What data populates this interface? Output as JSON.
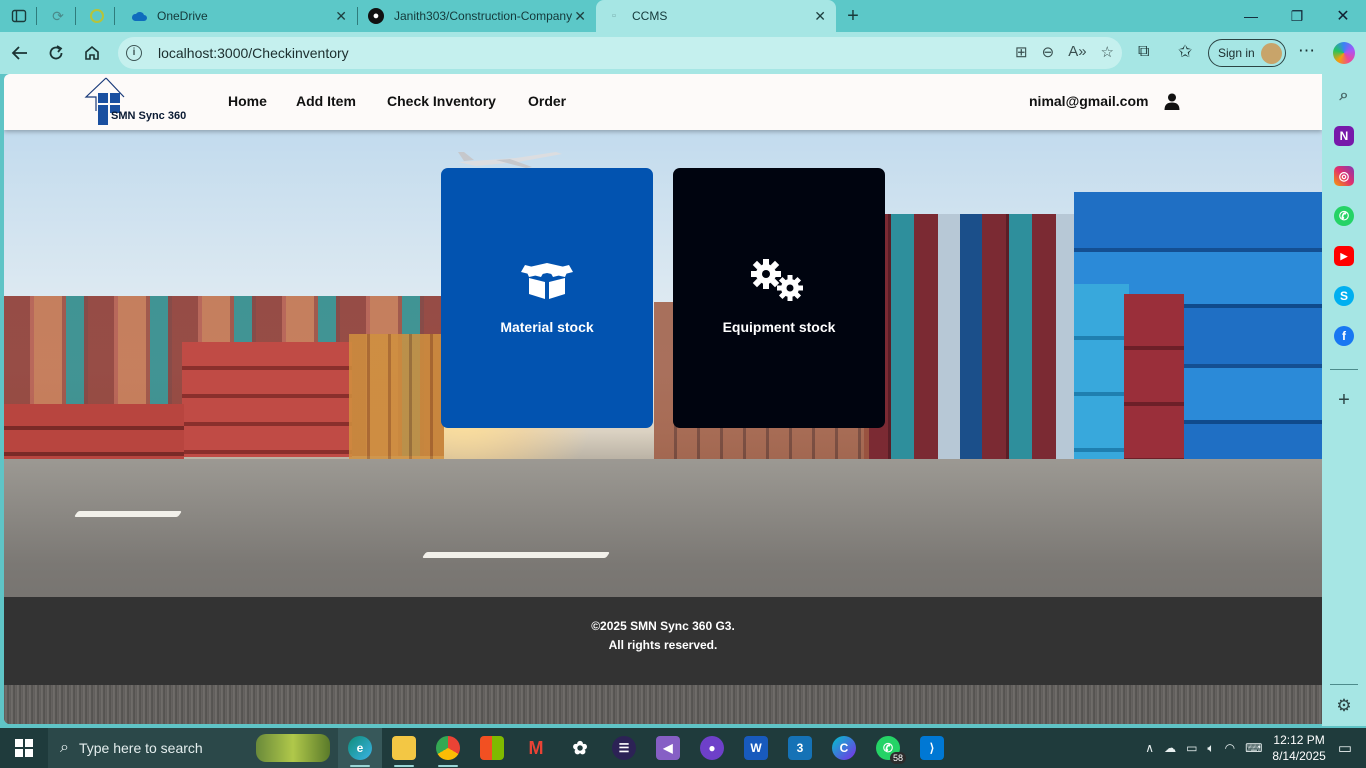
{
  "browser": {
    "tabs": [
      {
        "title": "OneDrive"
      },
      {
        "title": "Janith303/Construction-Company"
      },
      {
        "title": "CCMS"
      }
    ],
    "address": "localhost:3000/Checkinventory",
    "signin_label": "Sign in"
  },
  "site": {
    "logo_text": "SMN Sync 360",
    "nav": [
      {
        "label": "Home"
      },
      {
        "label": "Add Item"
      },
      {
        "label": "Check Inventory"
      },
      {
        "label": "Order"
      }
    ],
    "user_email": "nimal@gmail.com"
  },
  "cards": [
    {
      "label": "Material stock",
      "icon": "box-open-icon",
      "color": "#0253b0"
    },
    {
      "label": "Equipment stock",
      "icon": "gears-icon",
      "color": "#00040f"
    }
  ],
  "footer": {
    "line1": "©2025 SMN Sync 360 G3.",
    "line2": "All rights reserved."
  },
  "taskbar": {
    "search_placeholder": "Type here to search",
    "whatsapp_badge": "58",
    "time": "12:12 PM",
    "date": "8/14/2025"
  }
}
